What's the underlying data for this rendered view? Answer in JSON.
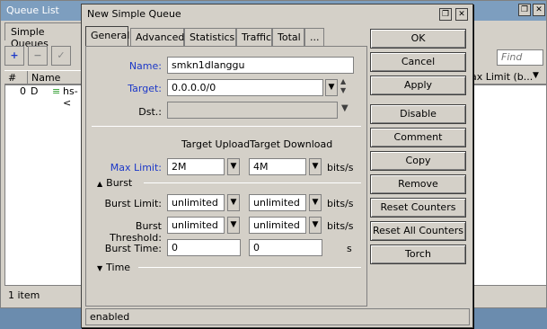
{
  "background": {
    "title": "Queue List",
    "tab": "Simple Queues",
    "columns": [
      "#",
      "Name"
    ],
    "row": {
      "index": "0",
      "flag": "D",
      "name": "hs-<"
    },
    "right_column": "ax Limit (b...",
    "find_placeholder": "Find",
    "status": "1 item"
  },
  "dialog": {
    "title": "New Simple Queue",
    "tabs": [
      "General",
      "Advanced",
      "Statistics",
      "Traffic",
      "Total",
      "..."
    ],
    "fields": {
      "name_label": "Name:",
      "name_value": "smkn1dlanggu",
      "target_label": "Target:",
      "target_value": "0.0.0.0/0",
      "dst_label": "Dst.:",
      "dst_value": ""
    },
    "columns": {
      "upload": "Target Upload",
      "download": "Target Download"
    },
    "max_limit": {
      "label": "Max Limit:",
      "upload": "2M",
      "download": "4M",
      "unit": "bits/s"
    },
    "burst_section": "Burst",
    "burst_limit": {
      "label": "Burst Limit:",
      "upload": "unlimited",
      "download": "unlimited",
      "unit": "bits/s"
    },
    "burst_threshold": {
      "label": "Burst Threshold:",
      "upload": "unlimited",
      "download": "unlimited",
      "unit": "bits/s"
    },
    "burst_time": {
      "label": "Burst Time:",
      "upload": "0",
      "download": "0",
      "unit": "s"
    },
    "time_section": "Time",
    "buttons": [
      "OK",
      "Cancel",
      "Apply",
      "Disable",
      "Comment",
      "Copy",
      "Remove",
      "Reset Counters",
      "Reset All Counters",
      "Torch"
    ],
    "status": "enabled"
  }
}
